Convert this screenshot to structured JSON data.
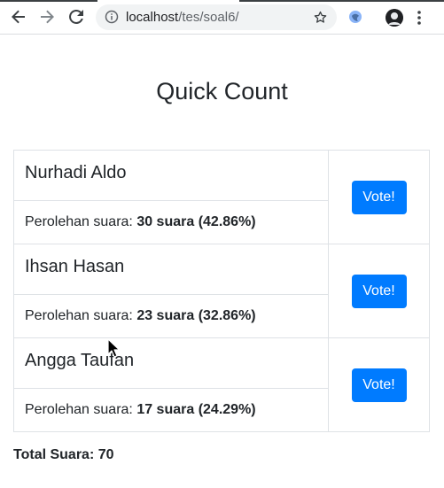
{
  "browser": {
    "url_host": "localhost",
    "url_path": "/tes/soal6/",
    "icons": [
      "back-icon",
      "forward-icon",
      "reload-icon",
      "info-icon",
      "star-icon",
      "extension-icon",
      "avatar-icon",
      "menu-icon"
    ]
  },
  "page": {
    "title": "Quick Count",
    "vote_label": "Vote!",
    "result_prefix": "Perolehan suara:",
    "candidates": [
      {
        "name": "Nurhadi Aldo",
        "result": "30 suara (42.86%)"
      },
      {
        "name": "Ihsan Hasan",
        "result": "23 suara (32.86%)"
      },
      {
        "name": "Angga Taufan",
        "result": "17 suara (24.29%)"
      }
    ],
    "total_label": "Total Suara: 70"
  },
  "colors": {
    "primary": "#007bff",
    "text": "#212529",
    "border": "#dee2e6"
  }
}
